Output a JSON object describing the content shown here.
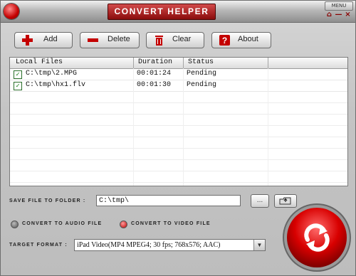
{
  "window": {
    "title": "CONVERT HELPER",
    "menu_label": "MENU",
    "controls": {
      "home_icon": "home-icon",
      "minimize": "—",
      "close": "×"
    }
  },
  "toolbar": [
    {
      "label": "Add",
      "icon": "add-icon"
    },
    {
      "label": "Delete",
      "icon": "delete-icon"
    },
    {
      "label": "Clear",
      "icon": "trash-icon"
    },
    {
      "label": "About",
      "icon": "help-icon"
    }
  ],
  "file_list": {
    "columns": [
      "Local Files",
      "Duration",
      "Status"
    ],
    "rows": [
      {
        "checked": true,
        "file": "C:\\tmp\\2.MPG",
        "duration": "00:01:24",
        "status": "Pending"
      },
      {
        "checked": true,
        "file": "C:\\tmp\\hx1.flv",
        "duration": "00:01:30",
        "status": "Pending"
      }
    ]
  },
  "save": {
    "label": "SAVE FILE TO FOLDER :",
    "path": "C:\\tmp\\",
    "browse_label": "...",
    "open_label": "⇧"
  },
  "mode": {
    "audio_label": "CONVERT TO AUDIO FILE",
    "video_label": "CONVERT TO VIDEO FILE",
    "selected": "video"
  },
  "target": {
    "label": "TARGET FORMAT :",
    "value": "iPad Video(MP4 MPEG4; 30 fps; 768x576; AAC)"
  },
  "colors": {
    "accent": "#c40000",
    "background": "#c4c4c4"
  }
}
